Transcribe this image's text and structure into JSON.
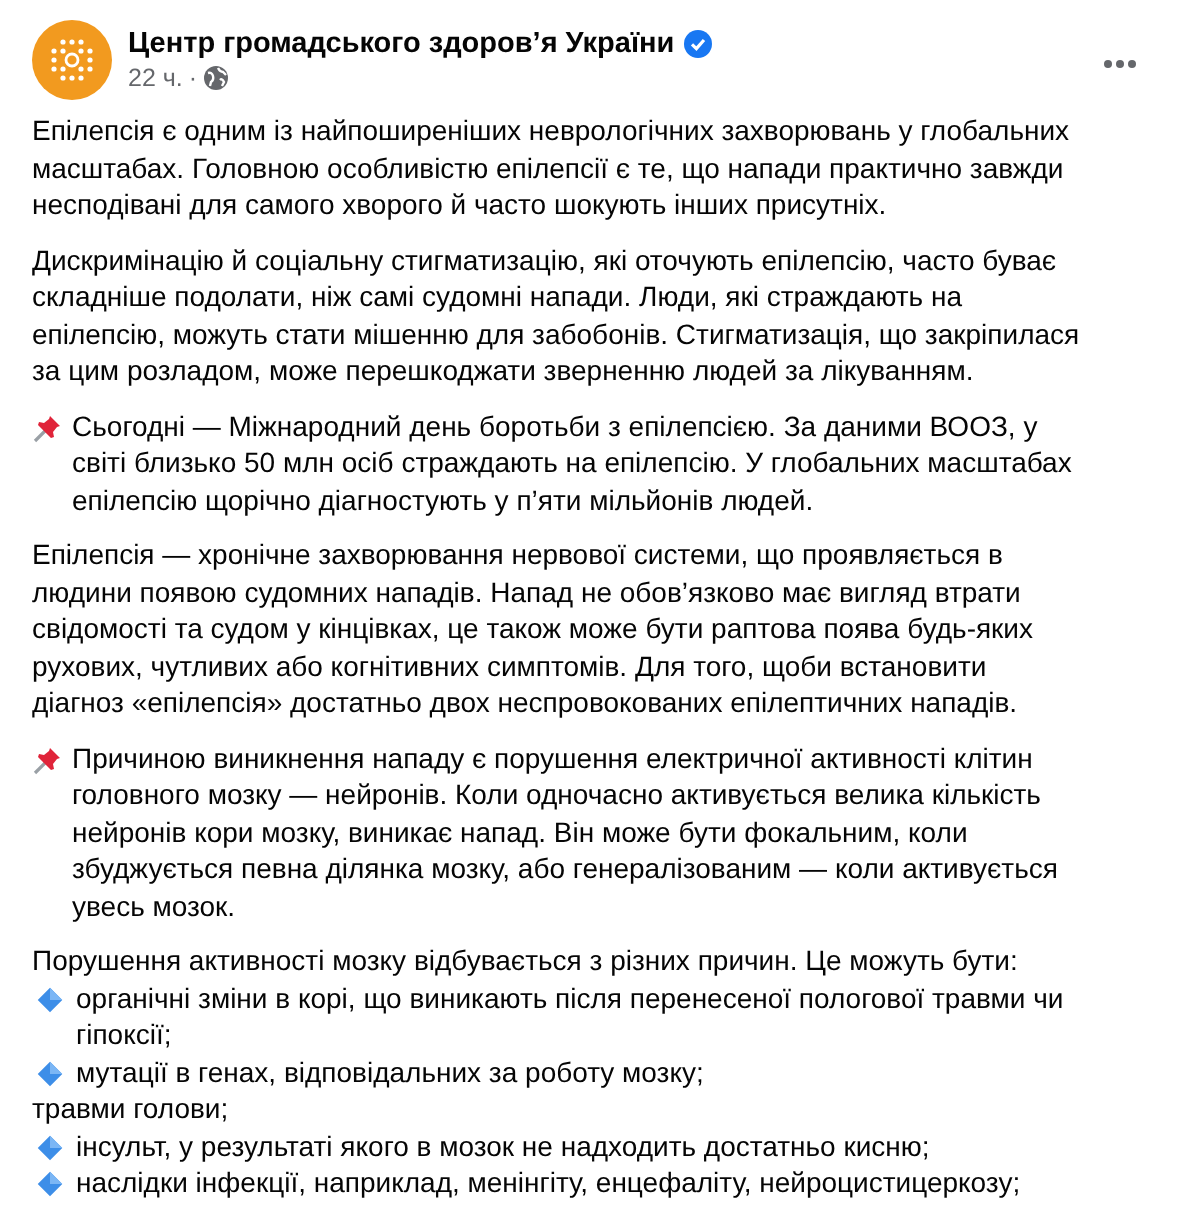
{
  "page": {
    "name": "Центр громадського здоров’я України",
    "verified": true,
    "time": "22 ч.",
    "separator": "·"
  },
  "paragraphs": [
    {
      "kind": "text",
      "lines": [
        "Епілепсія є одним із найпоширеніших неврологічних захворювань у глобальних",
        "масштабах. Головною особливістю епілепсії є те, що напади практично завжди",
        "несподівані для самого хворого й часто шокують інших присутніх."
      ]
    },
    {
      "kind": "text",
      "lines": [
        "Дискримінацію й соціальну стигматизацію, які оточують епілепсію, часто буває",
        "складніше подолати, ніж самі судомні напади. Люди, які страждають на",
        "епілепсію, можуть стати мішенню для забобонів. Стигматизація, що закріпилася",
        "за цим розладом, може перешкоджати зверненню людей за лікуванням."
      ]
    },
    {
      "kind": "pinned",
      "lines": [
        "Сьогодні — Міжнародний день боротьби з епілепсією. За даними ВООЗ, у",
        "світі близько 50 млн осіб страждають на епілепсію. У глобальних масштабах",
        "епілепсію щорічно діагностують у п’яти мільйонів людей."
      ]
    },
    {
      "kind": "text",
      "lines": [
        "Епілепсія — хронічне захворювання нервової системи, що проявляється в",
        "людини появою судомних нападів. Напад не обов’язково має вигляд втрати",
        "свідомості та судом у кінцівках, це також може бути раптова поява будь-яких",
        "рухових, чутливих або когнітивних симптомів. Для того, щоби встановити",
        "діагноз «епілепсія» достатньо двох неспровокованих епілептичних нападів."
      ]
    },
    {
      "kind": "pinned",
      "lines": [
        "Причиною виникнення нападу є порушення електричної активності клітин",
        "головного мозку — нейронів. Коли одночасно активується велика кількість",
        "нейронів кори мозку, виникає напад. Він може бути фокальним, коли",
        "збуджується певна ділянка мозку, або генералізованим — коли активується",
        "увесь мозок."
      ]
    }
  ],
  "list": {
    "intro": "Порушення активності мозку відбувається з різних причин. Це можуть бути:",
    "items": [
      {
        "kind": "bullet",
        "lines": [
          "органічні зміни в корі, що виникають після перенесеної пологової травми чи",
          "гіпоксії;"
        ]
      },
      {
        "kind": "bullet",
        "lines": [
          "мутації в генах, відповідальних за роботу мозку;"
        ]
      },
      {
        "kind": "plain",
        "lines": [
          "травми голови;"
        ]
      },
      {
        "kind": "bullet",
        "lines": [
          "інсульт, у результаті якого в мозок не надходить достатньо кисню;"
        ]
      },
      {
        "kind": "bullet",
        "lines": [
          "наслідки інфекції, наприклад, менінгіту, енцефаліту, нейроцистицеркозу;"
        ]
      }
    ]
  }
}
